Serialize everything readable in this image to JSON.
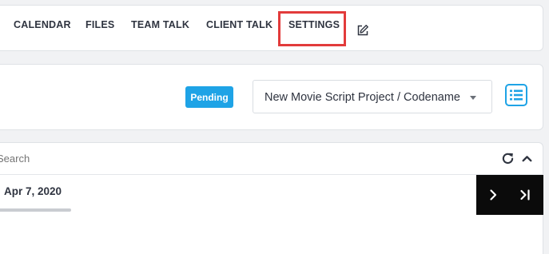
{
  "nav": {
    "items": [
      {
        "label": "CALENDAR"
      },
      {
        "label": "FILES"
      },
      {
        "label": "TEAM TALK"
      },
      {
        "label": "CLIENT TALK"
      },
      {
        "label": "SETTINGS",
        "highlighted": true
      }
    ],
    "edit_icon": "edit-icon",
    "highlight_color": "#e23b3b"
  },
  "project": {
    "status_badge": "Pending",
    "status_color": "#1ea3e6",
    "selected_project": "New Movie Script Project / Codename",
    "list_icon": "list-view-icon",
    "accent": "#1ea3e6"
  },
  "panel": {
    "search_placeholder": "Search",
    "refresh_icon": "refresh-icon",
    "collapse_icon": "chevron-up-icon",
    "row": {
      "date": "Apr 7, 2020"
    },
    "pager": {
      "next_icon": "chevron-right-icon",
      "last_icon": "last-page-icon"
    }
  }
}
